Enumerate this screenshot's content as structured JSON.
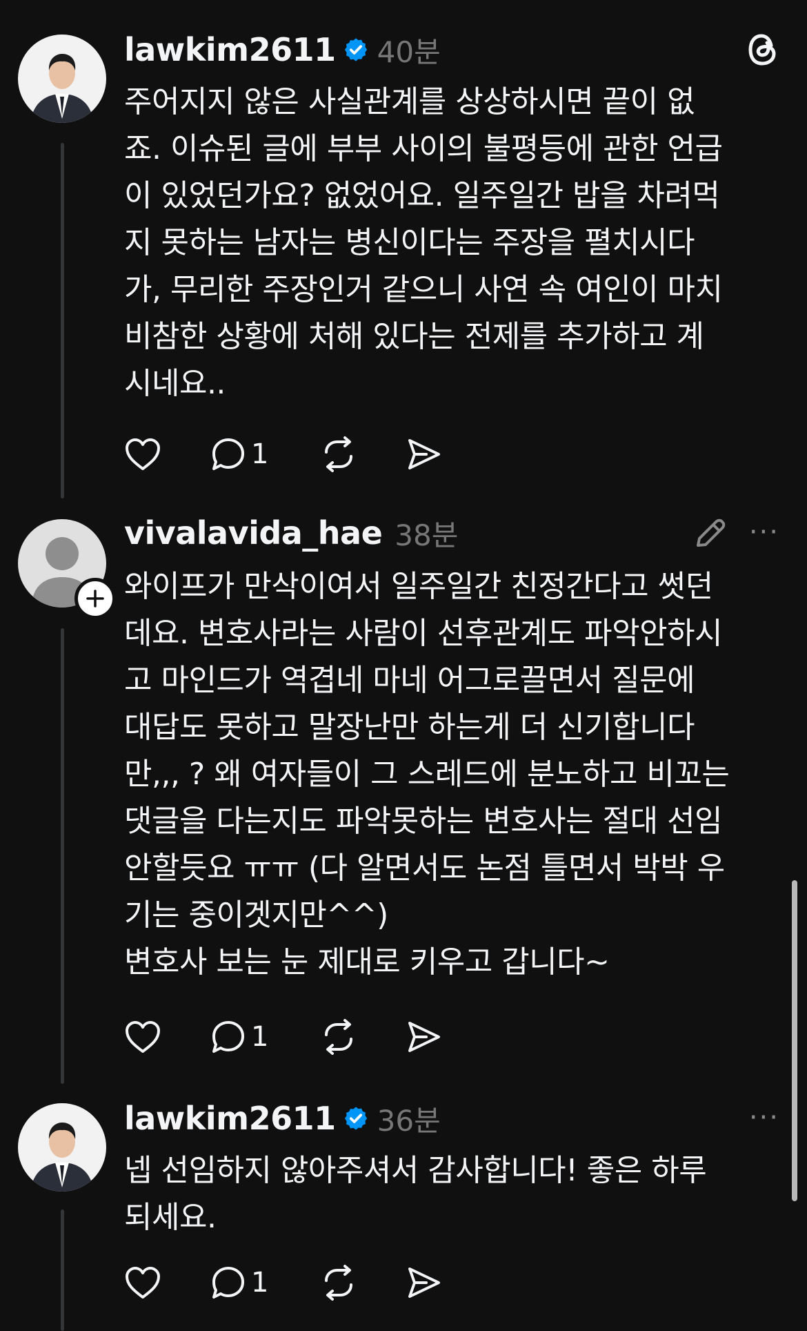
{
  "app": {
    "logo_icon": "threads-logo-icon"
  },
  "posts": [
    {
      "avatar": "profile-photo-man-in-suit",
      "username": "lawkim2611",
      "verified": true,
      "time": "40분",
      "text": "주어지지 않은 사실관계를 상상하시면 끝이 없\n죠. 이슈된 글에 부부 사이의 불평등에 관한 언급\n이 있었던가요? 없었어요. 일주일간 밥을 차려먹\n지 못하는 남자는 병신이다는 주장을 펼치시다\n가, 무리한 주장인거 같으니 사연 속 여인이 마치\n비참한 상황에 처해 있다는 전제를 추가하고 계\n시네요..",
      "reply_count": "1"
    },
    {
      "avatar": "default-avatar",
      "username": "vivalavida_hae",
      "verified": false,
      "time": "38분",
      "more_label": "···",
      "text": "와이프가 만삭이여서 일주일간 친정간다고 썻던\n데요. 변호사라는 사람이 선후관계도 파악안하시\n고 마인드가 역겹네 마네 어그로끌면서 질문에\n대답도 못하고 말장난만 하는게 더 신기합니다\n만,,, ? 왜 여자들이 그 스레드에 분노하고 비꼬는\n댓글을 다는지도 파악못하는 변호사는 절대 선임\n안할듯요 ㅠㅠ (다 알면서도 논점 틀면서 박박 우\n기는 중이겟지만^^)\n변호사 보는 눈 제대로 키우고 갑니다~",
      "reply_count": "1"
    },
    {
      "avatar": "profile-photo-man-in-suit",
      "username": "lawkim2611",
      "verified": true,
      "time": "36분",
      "more_label": "···",
      "text": "넵 선임하지 않아주셔서 감사합니다! 좋은 하루\n되세요.",
      "reply_count": "1"
    }
  ],
  "colors": {
    "background": "#101010",
    "text": "#f3f5f7",
    "muted": "#777777",
    "verified": "#0095f6",
    "thread_line": "#333638"
  }
}
